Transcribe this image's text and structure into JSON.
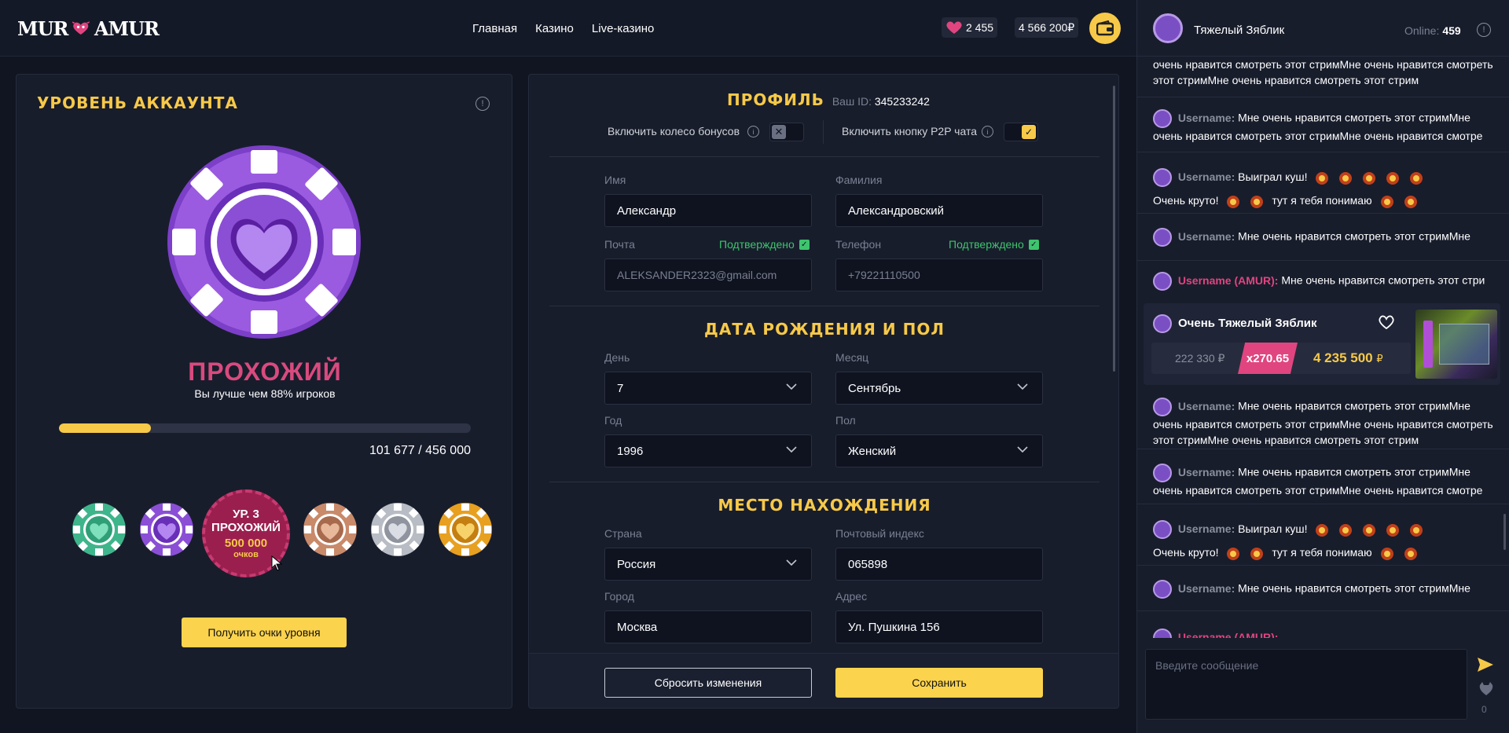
{
  "header": {
    "logo_left": "MUR",
    "logo_right": "AMUR",
    "nav": [
      "Главная",
      "Казино",
      "Live-казино"
    ],
    "bonus_balance": "2 455",
    "balance": "4 566 200₽"
  },
  "account_level": {
    "title": "УРОВЕНЬ АККАУНТА",
    "rank": "ПРОХОЖИЙ",
    "rank_sub": "Вы лучше чем 88% игроков",
    "progress_text": "101 677 / 456 000",
    "progress_fraction": 0.223,
    "active_chip": {
      "line1": "УР. 3",
      "line2": "ПРОХОЖИЙ",
      "points": "500 000",
      "points_label": "очков"
    },
    "get_points_button": "Получить очки уровня"
  },
  "profile": {
    "title": "ПРОФИЛЬ",
    "id_label": "Ваш ID:",
    "id_value": "345233242",
    "toggle_bonus_wheel": "Включить колесо бонусов",
    "toggle_p2p_chat": "Включить кнопку P2P чата",
    "first_name_label": "Имя",
    "first_name": "Александр",
    "last_name_label": "Фамилия",
    "last_name": "Александровский",
    "email_label": "Почта",
    "email": "ALEKSANDER2323@gmail.com",
    "phone_label": "Телефон",
    "phone": "+79221110500",
    "verified": "Подтверждено",
    "birth_section": "ДАТА РОЖДЕНИЯ И ПОЛ",
    "day_label": "День",
    "day": "7",
    "month_label": "Месяц",
    "month": "Сентябрь",
    "year_label": "Год",
    "year": "1996",
    "gender_label": "Пол",
    "gender": "Женский",
    "location_section": "МЕСТО НАХОЖДЕНИЯ",
    "country_label": "Страна",
    "country": "Россия",
    "zip_label": "Почтовый индекс",
    "zip": "065898",
    "city_label": "Город",
    "city": "Москва",
    "address_label": "Адрес",
    "address": "Ул. Пушкина 156",
    "reset_button": "Сбросить изменения",
    "save_button": "Сохранить"
  },
  "chat": {
    "user_name": "Тяжелый Зяблик",
    "online_label": "Online:",
    "online_count": "459",
    "top_fragment": "очень нравится смотреть этот стримМне очень нравится смотреть этот стримМне очень нравится смотреть этот стрим",
    "username": "Username:",
    "username_amur": "Username (AMUR):",
    "msg_long1": "Мне очень нравится смотреть этот стримМне очень нравится смотреть этот стримМне очень нравится смотре",
    "msg_win_a": "Выиграл куш!",
    "msg_win_b": "Очень круто!",
    "msg_win_c": "тут я тебя понимаю",
    "msg_short": "Мне очень нравится смотреть этот стримМне",
    "msg_amur": "Мне очень нравится смотреть этот стри",
    "win_card_user": "Очень Тяжелый Зяблик",
    "win_bet": "222 330 ₽",
    "win_mult": "x270.65",
    "win_amount": "4 235 500",
    "win_currency": "₽",
    "msg_long3": "Мне очень нравится смотреть этот стримМне очень нравится смотреть этот стримМне очень нравится смотреть этот стримМне очень нравится смотреть этот стрим",
    "msg_long4": "Мне очень нравится смотреть этот стримМне очень нравится смотреть этот стримМне очень нравится смотре",
    "input_placeholder": "Введите сообщение",
    "char_count": "0"
  },
  "colors": {
    "accent": "#f7c948",
    "pink": "#e0457f",
    "green": "#3ec46d",
    "purple": "#7b4fc4"
  }
}
